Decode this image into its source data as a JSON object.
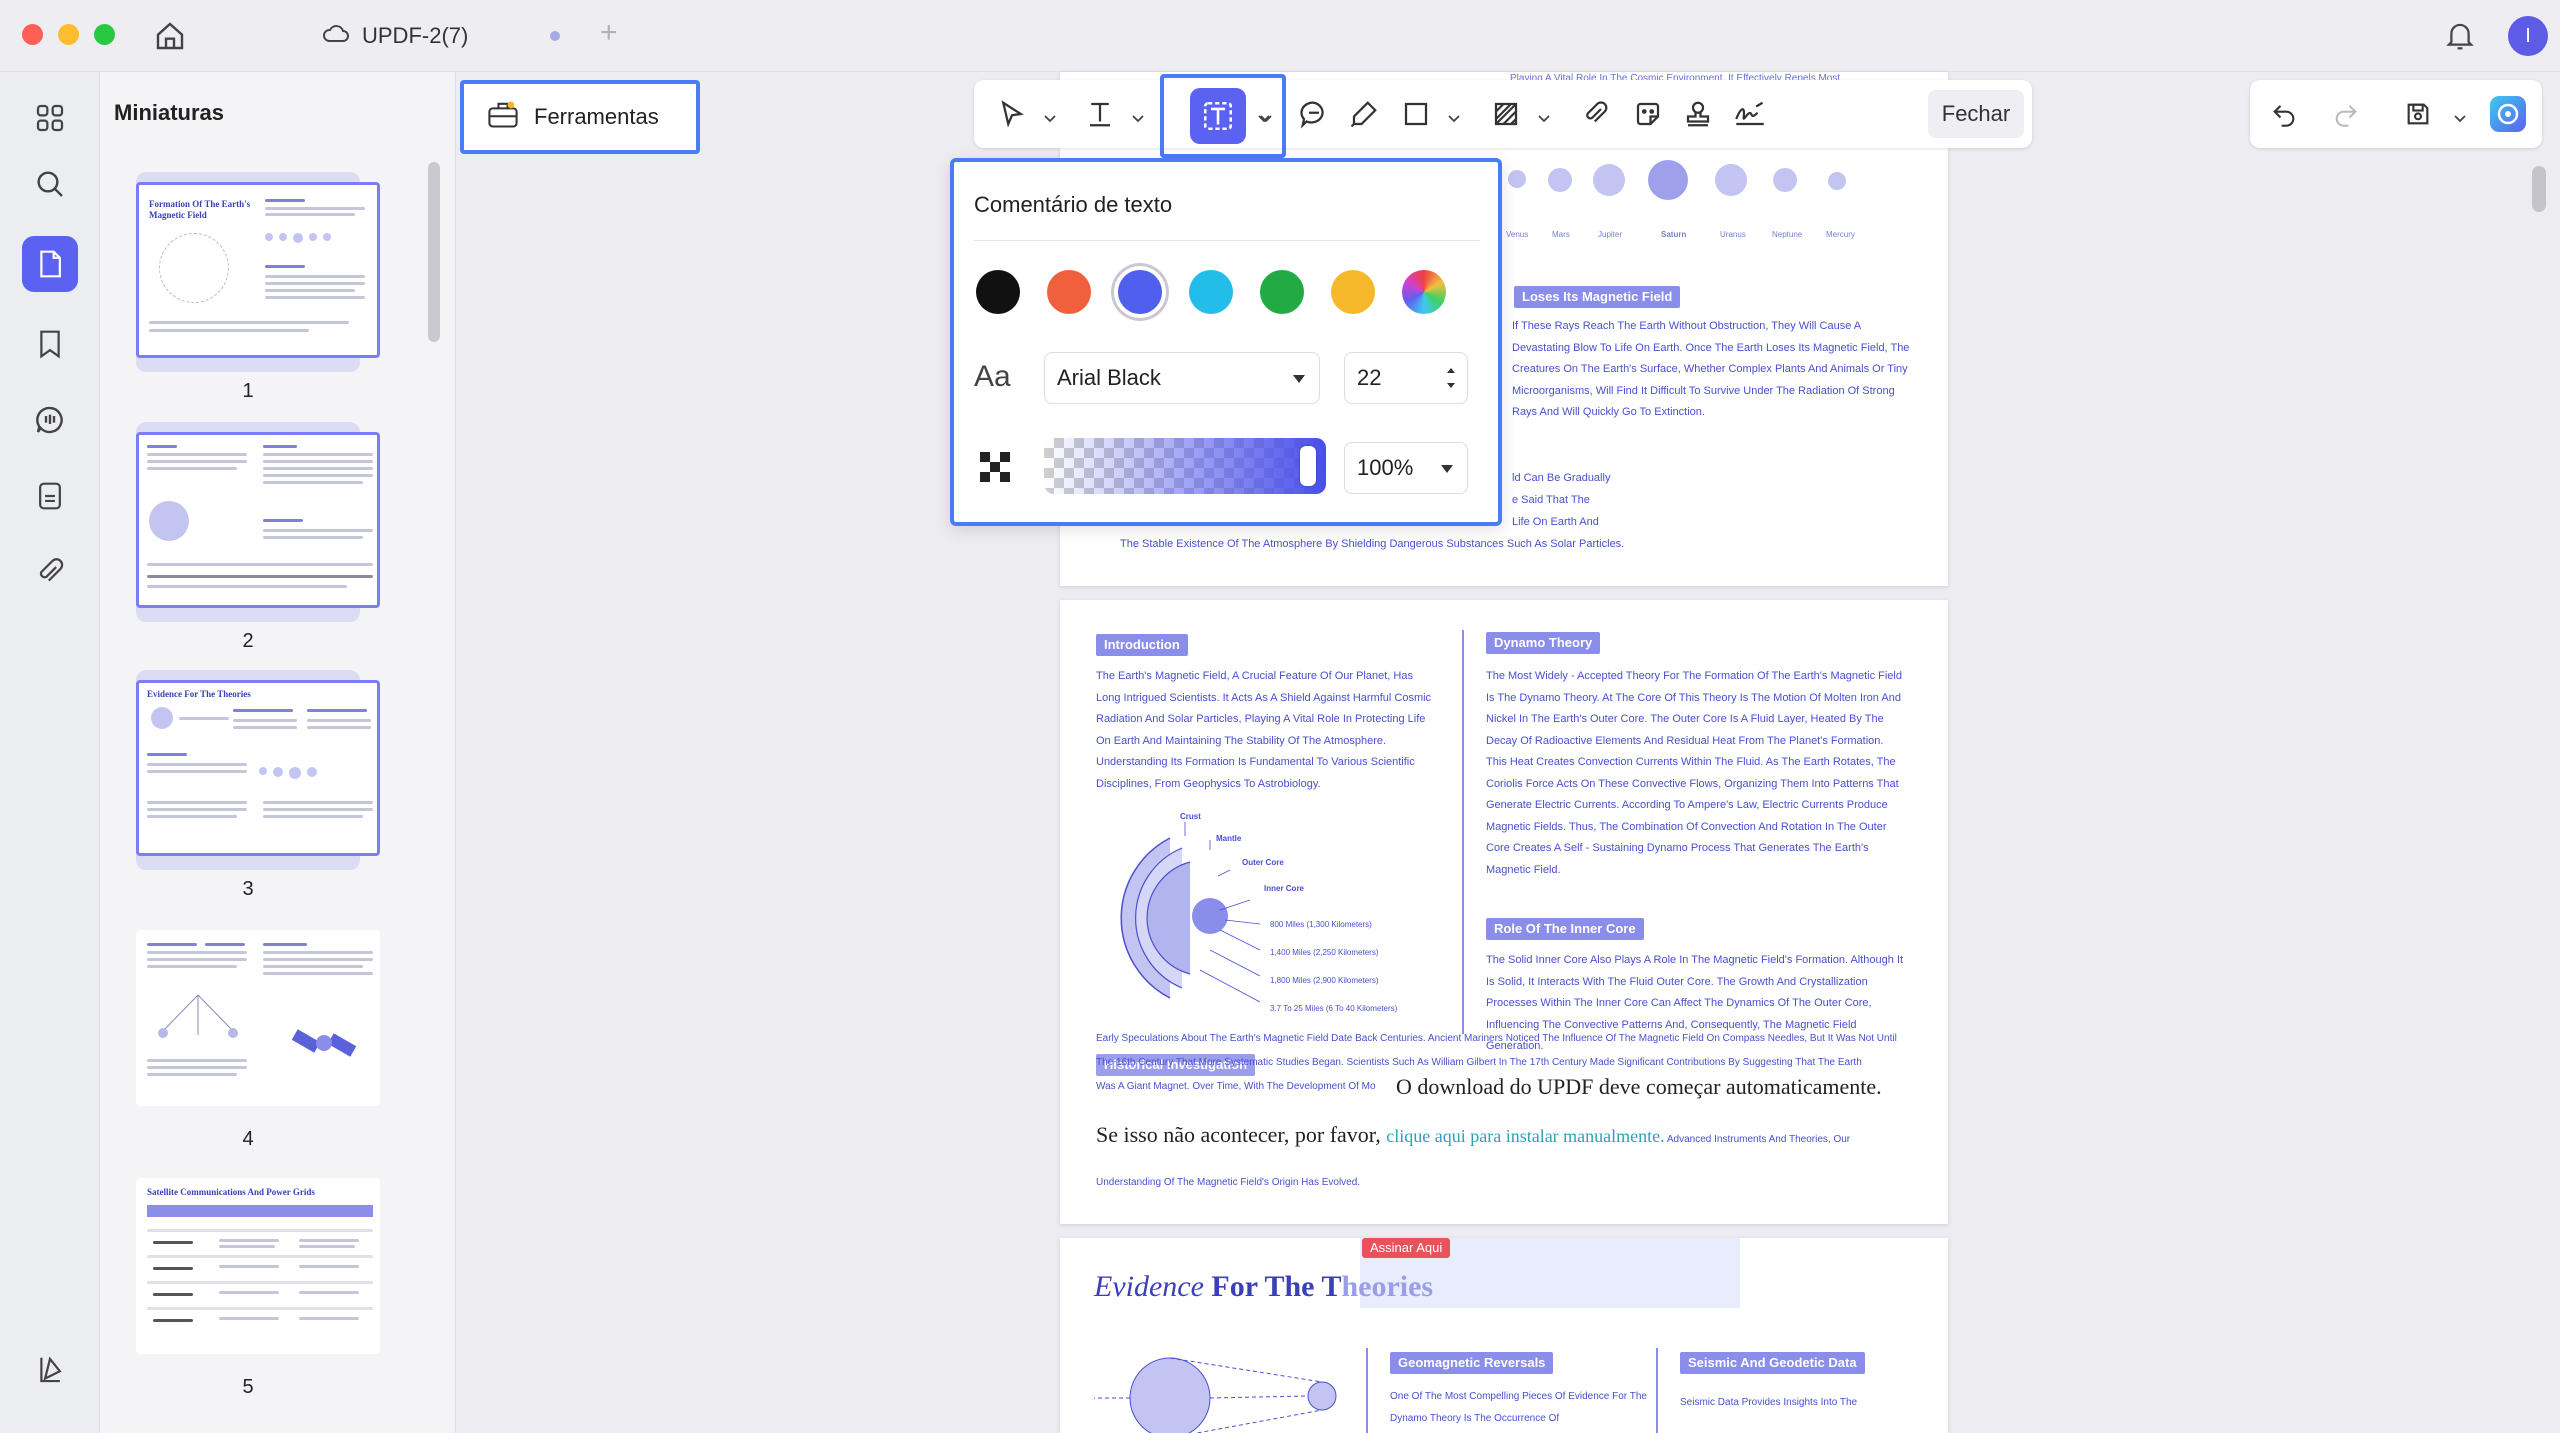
{
  "window": {
    "doc_title": "UPDF-2(7)",
    "tab_plus": "+",
    "avatar_letter": "I"
  },
  "sidebar": {
    "title": "Miniaturas",
    "pages": [
      "1",
      "2",
      "3",
      "4",
      "5"
    ]
  },
  "toolbar": {
    "tools_label": "Ferramentas",
    "close_label": "Fechar"
  },
  "popup": {
    "title": "Comentário de texto",
    "colors": [
      "#111111",
      "#f0603c",
      "#5060ee",
      "#22bde8",
      "#22aa44",
      "#f5b82a",
      "rainbow"
    ],
    "selected_color": "#5060ee",
    "font_icon": "Aa",
    "font": "Arial Black",
    "size": "22",
    "opacity": "100%",
    "opacity_value": 1.0
  },
  "document": {
    "p1": {
      "header": "Playing A Vital Role In The Cosmic Environment. It Effectively Repels Most",
      "planets": [
        "Venus",
        "Mars",
        "Jupiter",
        "Saturn",
        "Uranus",
        "Neptune",
        "Mercury"
      ],
      "tag": "Loses Its Magnetic Field",
      "para": "If These Rays Reach The Earth Without Obstruction, They Will Cause A Devastating Blow To Life On Earth. Once The Earth Loses Its Magnetic Field, The Creatures On The Earth's Surface, Whether Complex Plants And Animals Or Tiny Microorganisms, Will Find It Difficult To Survive Under The Radiation Of Strong Rays And Will Quickly Go To Extinction.",
      "frag1": "ld Can Be Gradually",
      "frag2": "e Said That The",
      "frag3": "Life On Earth And",
      "bottom": "The Stable Existence Of The Atmosphere By Shielding Dangerous Substances Such As Solar Particles."
    },
    "p2": {
      "intro_tag": "Introduction",
      "intro_text": "The Earth's Magnetic Field, A Crucial Feature Of Our Planet, Has Long Intrigued Scientists. It Acts As A Shield Against Harmful Cosmic Radiation And Solar Particles, Playing A Vital Role In Protecting Life On Earth And Maintaining The Stability Of The Atmosphere. Understanding Its Formation Is Fundamental To Various Scientific Disciplines, From Geophysics To Astrobiology.",
      "dynamo_tag": "Dynamo Theory",
      "dynamo_text": "The Most Widely - Accepted Theory For The Formation Of The Earth's Magnetic Field Is The Dynamo Theory. At The Core Of This Theory Is The Motion Of Molten Iron And Nickel In The Earth's Outer Core. The Outer Core Is A Fluid Layer, Heated By The Decay Of Radioactive Elements And Residual Heat From The Planet's Formation. This Heat Creates Convection Currents Within The Fluid. As The Earth Rotates, The Coriolis Force Acts On These Convective Flows, Organizing Them Into Patterns That Generate Electric Currents. According To Ampere's Law, Electric Currents Produce Magnetic Fields. Thus, The Combination Of Convection And Rotation In The Outer Core Creates A Self - Sustaining Dynamo Process That Generates The Earth's Magnetic Field.",
      "inner_tag": "Role Of The Inner Core",
      "inner_text": "The Solid Inner Core Also Plays A Role In The Magnetic Field's Formation. Although It Is Solid, It Interacts With The Fluid Outer Core. The Growth And Crystallization Processes Within The Inner Core Can Affect The Dynamics Of The Outer Core, Influencing The Convective Patterns And, Consequently, The Magnetic Field Generation.",
      "diagram_labels": [
        "Crust",
        "Mantle",
        "Outer Core",
        "Inner Core",
        "800 Miles (1,300 Kilometers)",
        "1,400 Miles (2,250 Kilometers)",
        "1,800 Miles (2,900 Kilometers)",
        "3.7 To 25 Miles (6 To 40 Kilometers)"
      ],
      "history_tag": "Historical Investigation",
      "history_line1": "Early Speculations About The Earth's Magnetic Field Date Back Centuries. Ancient Mariners Noticed The Influence Of The Magnetic Field On Compass Needles, But It Was Not Until",
      "history_line2": "The 16th Century That More Systematic Studies Began. Scientists Such As William Gilbert In The 17th Century Made Significant Contributions By Suggesting That The Earth",
      "history_line3": "Was A Giant Magnet. Over Time, With The Development Of Mo",
      "download_line1": "O download do UPDF deve começar automaticamente.",
      "download_line2": "Se isso não acontecer, por favor, ",
      "download_link": "clique aqui para instalar manualmente.",
      "download_tail": " Advanced Instruments And Theories, Our",
      "last_line": "Understanding Of The Magnetic Field's Origin Has Evolved."
    },
    "p3": {
      "sign_badge": "Assinar Aqui",
      "evidence_italic": "Evidence",
      "evidence_bold": " For The T",
      "evidence_rest": "heories",
      "geo_tag": "Geomagnetic Reversals",
      "geo_text": "One Of The Most Compelling Pieces Of Evidence For The Dynamo Theory Is The Occurrence Of",
      "seis_tag": "Seismic And Geodetic Data",
      "seis_text": "Seismic Data Provides Insights Into The"
    }
  },
  "thumbs_text": {
    "t1_title": "Formation Of The Earth's Magnetic Field",
    "t3_title": "Evidence For The Theories",
    "t5_title": "Satellite Communications And Power Grids"
  }
}
